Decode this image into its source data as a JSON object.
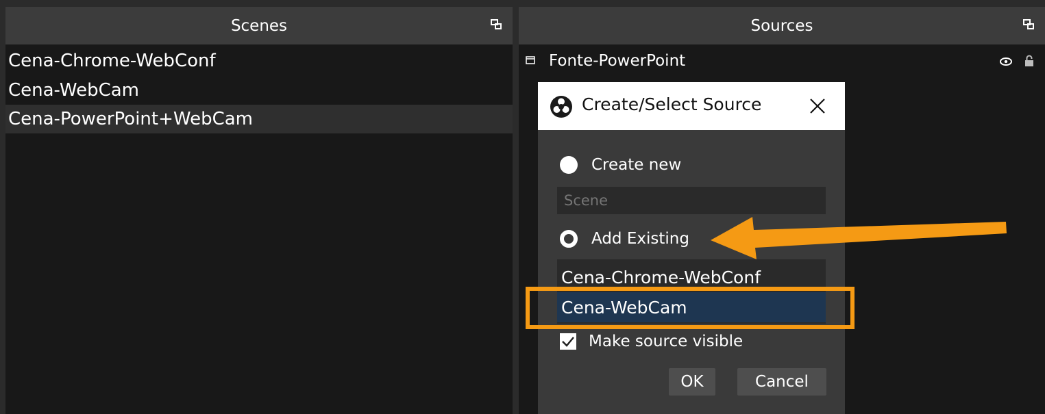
{
  "scenes_panel": {
    "title": "Scenes",
    "items": [
      "Cena-Chrome-WebConf",
      "Cena-WebCam",
      "Cena-PowerPoint+WebCam"
    ],
    "selected_index": 2
  },
  "sources_panel": {
    "title": "Sources",
    "items": [
      {
        "name": "Fonte-PowerPoint"
      }
    ]
  },
  "dialog": {
    "title": "Create/Select Source",
    "create_new_label": "Create new",
    "name_placeholder": "Scene",
    "add_existing_label": "Add Existing",
    "existing_items": [
      "Cena-Chrome-WebConf",
      "Cena-WebCam"
    ],
    "make_visible_label": "Make source visible",
    "make_visible_checked": true,
    "ok_label": "OK",
    "cancel_label": "Cancel",
    "selected_mode": "Add Existing",
    "selected_existing": "Cena-WebCam"
  },
  "colors": {
    "annotation": "#f59a14",
    "selection": "#1e3651",
    "panel_background": "#181818",
    "header_background": "#3c3c3c"
  },
  "icons": [
    "undock-icon",
    "source-type-icon",
    "eye-icon",
    "lock-icon",
    "obs-logo-icon",
    "close-icon",
    "check-icon",
    "arrow-annotation"
  ]
}
